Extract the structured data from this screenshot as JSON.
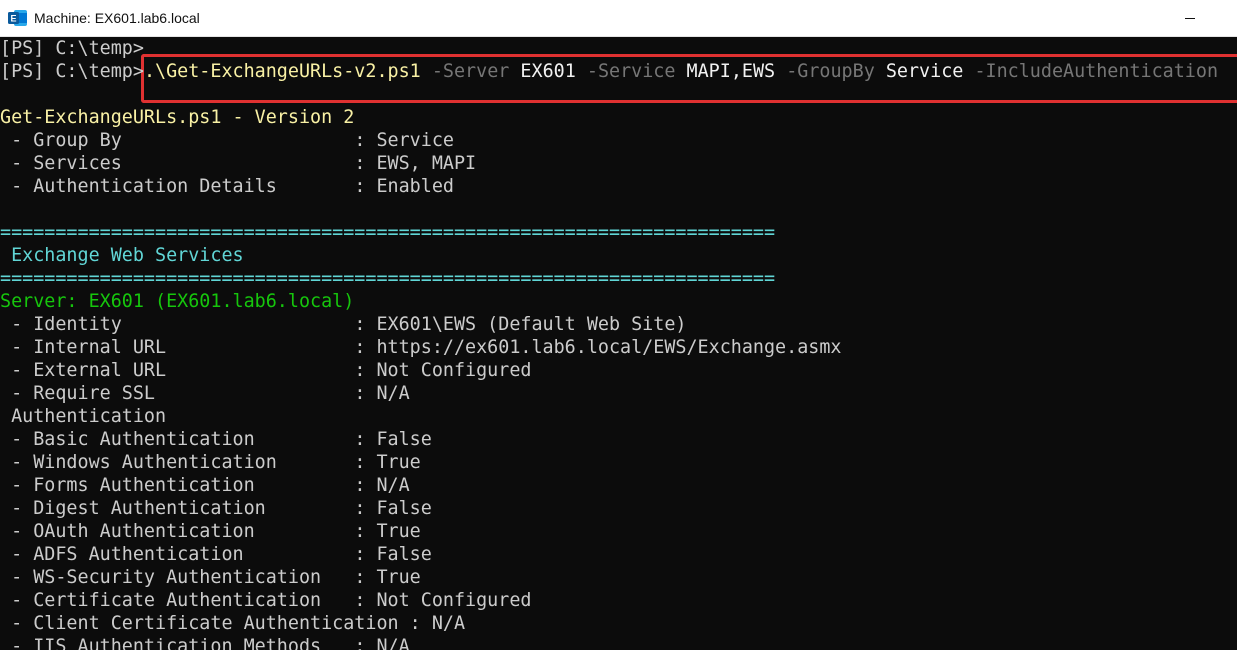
{
  "window": {
    "title": "Machine: EX601.lab6.local",
    "icon": "exchange-app-icon"
  },
  "colors": {
    "background": "#0c0c0c",
    "default_text": "#cccccc",
    "parameter": "#767676",
    "command": "#f9f1a5",
    "heading": "#61d6d6",
    "server": "#16c60c",
    "highlight_box": "#e03131"
  },
  "console": {
    "prompt1": "[PS] C:\\temp>",
    "prompt2": "[PS] C:\\temp>",
    "command": {
      "script": ".\\Get-ExchangeURLs-v2.ps1",
      "p1": "-Server",
      "v1": "EX601",
      "p2": "-Service",
      "v2": "MAPI,EWS",
      "p3": "-GroupBy",
      "v3": "Service",
      "p4": "-IncludeAuthentication"
    },
    "version_line": "Get-ExchangeURLs.ps1 - Version 2",
    "settings": [
      {
        "label": " - Group By                     ",
        "value": ": Service"
      },
      {
        "label": " - Services                     ",
        "value": ": EWS, MAPI"
      },
      {
        "label": " - Authentication Details       ",
        "value": ": Enabled"
      }
    ],
    "separator": "======================================================================",
    "section_title": " Exchange Web Services",
    "server_line": "Server: EX601 (EX601.lab6.local)",
    "properties": [
      {
        "label": " - Identity                     ",
        "value": ": EX601\\EWS (Default Web Site)"
      },
      {
        "label": " - Internal URL                 ",
        "value": ": https://ex601.lab6.local/EWS/Exchange.asmx"
      },
      {
        "label": " - External URL                 ",
        "value": ": Not Configured"
      },
      {
        "label": " - Require SSL                  ",
        "value": ": N/A"
      }
    ],
    "auth_heading": " Authentication",
    "auth": [
      {
        "label": " - Basic Authentication         ",
        "value": ": False"
      },
      {
        "label": " - Windows Authentication       ",
        "value": ": True"
      },
      {
        "label": " - Forms Authentication         ",
        "value": ": N/A"
      },
      {
        "label": " - Digest Authentication        ",
        "value": ": False"
      },
      {
        "label": " - OAuth Authentication         ",
        "value": ": True"
      },
      {
        "label": " - ADFS Authentication          ",
        "value": ": False"
      },
      {
        "label": " - WS-Security Authentication   ",
        "value": ": True"
      },
      {
        "label": " - Certificate Authentication   ",
        "value": ": Not Configured"
      },
      {
        "label": " - Client Certificate Authentication ",
        "value": ": N/A"
      },
      {
        "label": " - IIS Authentication Methods   ",
        "value": ": N/A"
      }
    ]
  }
}
